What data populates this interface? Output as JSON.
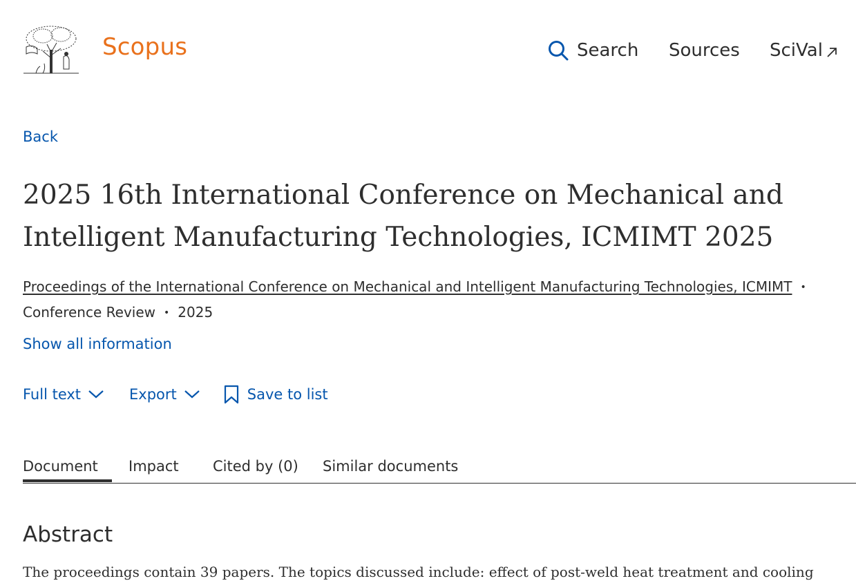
{
  "header": {
    "brand": "Scopus",
    "nav": {
      "search": "Search",
      "sources": "Sources",
      "scival": "SciVal"
    }
  },
  "back_label": "Back",
  "document": {
    "title": "2025 16th International Conference on Mechanical and Intelligent Manufacturing Technologies, ICMIMT 2025",
    "source_title": "Proceedings of the International Conference on Mechanical and Intelligent Manufacturing Technologies, ICMIMT",
    "doc_type": "Conference Review",
    "year": "2025",
    "show_all": "Show all information"
  },
  "actions": {
    "full_text": "Full text",
    "export": "Export",
    "save": "Save to list"
  },
  "tabs": [
    {
      "label": "Document"
    },
    {
      "label": "Impact"
    },
    {
      "label": "Cited by (0)"
    },
    {
      "label": "Similar documents"
    }
  ],
  "abstract": {
    "heading": "Abstract",
    "text": "The proceedings contain 39 papers. The topics discussed include: effect of post-weld heat treatment and cooling"
  },
  "colors": {
    "brand": "#e9711c",
    "link": "#0656ad",
    "text": "#2e2e2e"
  },
  "icons": {
    "logo": "elsevier-tree-logo",
    "search": "search-icon",
    "external": "external-link-icon",
    "chevron": "chevron-down-icon",
    "bookmark": "bookmark-icon"
  }
}
